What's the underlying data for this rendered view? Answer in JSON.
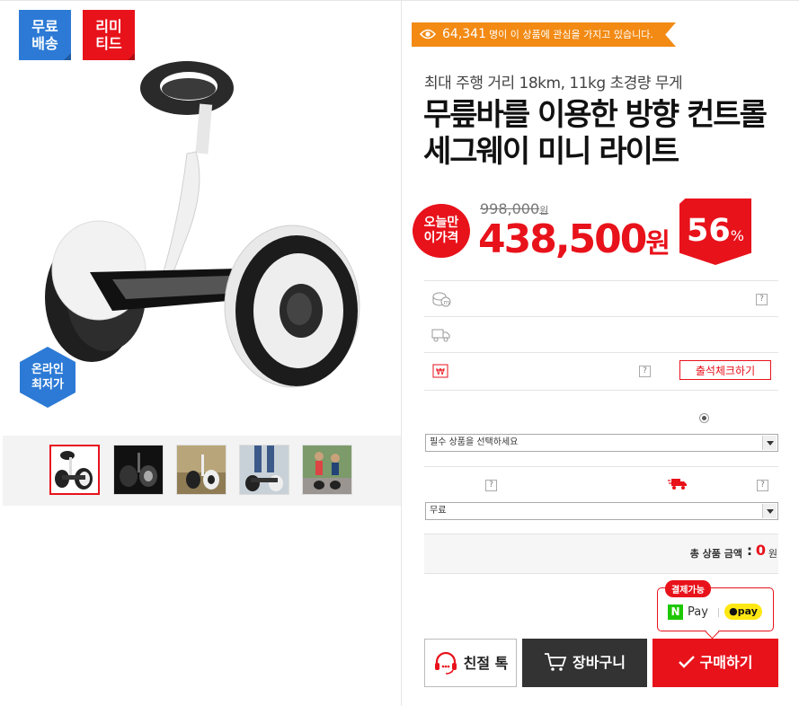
{
  "badges": {
    "free_shipping": "무료\n배송",
    "limited": "리미\n티드",
    "online_lowest": "온라인\n최저가"
  },
  "interest": {
    "count": "64,341",
    "text": "명이 이 상품에 관심을 가지고 있습니다."
  },
  "product": {
    "subtitle": "최대 주행 거리 18km, 11kg 초경량 무게",
    "title": "무릎바를 이용한 방향 컨트롤 세그웨이 미니 라이트"
  },
  "price": {
    "today_badge": "오늘만\n이가격",
    "original": "998,000",
    "original_unit": "원",
    "sale": "438,500",
    "sale_unit": "원",
    "discount": "56",
    "discount_unit": "%"
  },
  "info_rows": {
    "checkin_button": "출석체크하기",
    "help": "?"
  },
  "options": {
    "required_select": "필수 상품을 선택하세요",
    "shipping_select": "무료"
  },
  "total": {
    "label": "총 상품 금액",
    "colon": ":",
    "value": "0",
    "unit": "원"
  },
  "payment": {
    "available": "결제가능",
    "npay_logo": "N",
    "npay": "Pay",
    "kakaopay": "pay"
  },
  "actions": {
    "chat": "친절 톡",
    "cart": "장바구니",
    "buy": "구매하기"
  },
  "colors": {
    "accent": "#e8121b",
    "blue": "#2c7ad6",
    "orange": "#f28a14"
  },
  "thumbnails": [
    "segway-white-front",
    "segway-dark",
    "segway-outdoor",
    "riders-feet",
    "riders-park"
  ]
}
